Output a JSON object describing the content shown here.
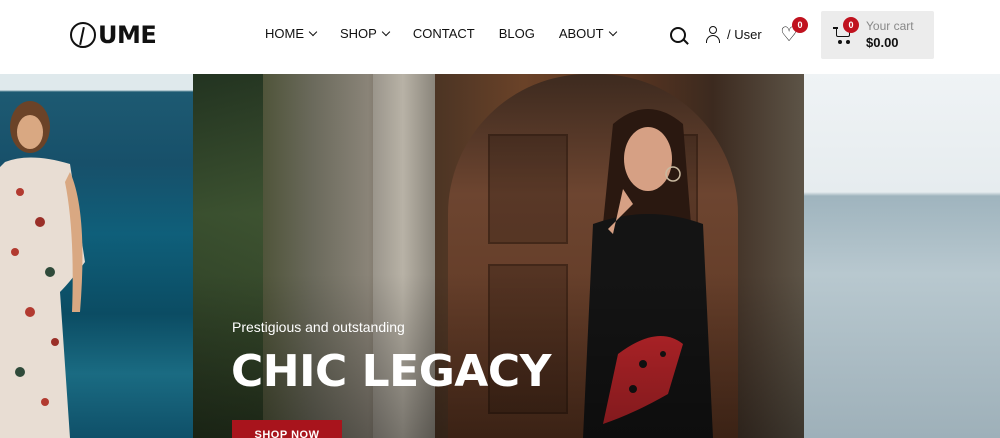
{
  "brand": {
    "logo_text": "UME"
  },
  "nav": {
    "items": [
      {
        "label": "HOME",
        "dropdown": true
      },
      {
        "label": "SHOP",
        "dropdown": true
      },
      {
        "label": "CONTACT",
        "dropdown": false
      },
      {
        "label": "BLOG",
        "dropdown": false
      },
      {
        "label": "ABOUT",
        "dropdown": true
      }
    ]
  },
  "header_tools": {
    "search_icon": "search-icon",
    "user_label": "/ User",
    "wishlist_count": "0",
    "cart_count": "0",
    "cart_label": "Your cart",
    "cart_total": "$0.00"
  },
  "hero": {
    "subtitle": "Prestigious and outstanding",
    "title": "CHIC LEGACY",
    "button_label": "SHOP NOW"
  },
  "colors": {
    "accent": "#a8141c",
    "badge": "#c0121f",
    "cart_bg": "#ececec"
  }
}
